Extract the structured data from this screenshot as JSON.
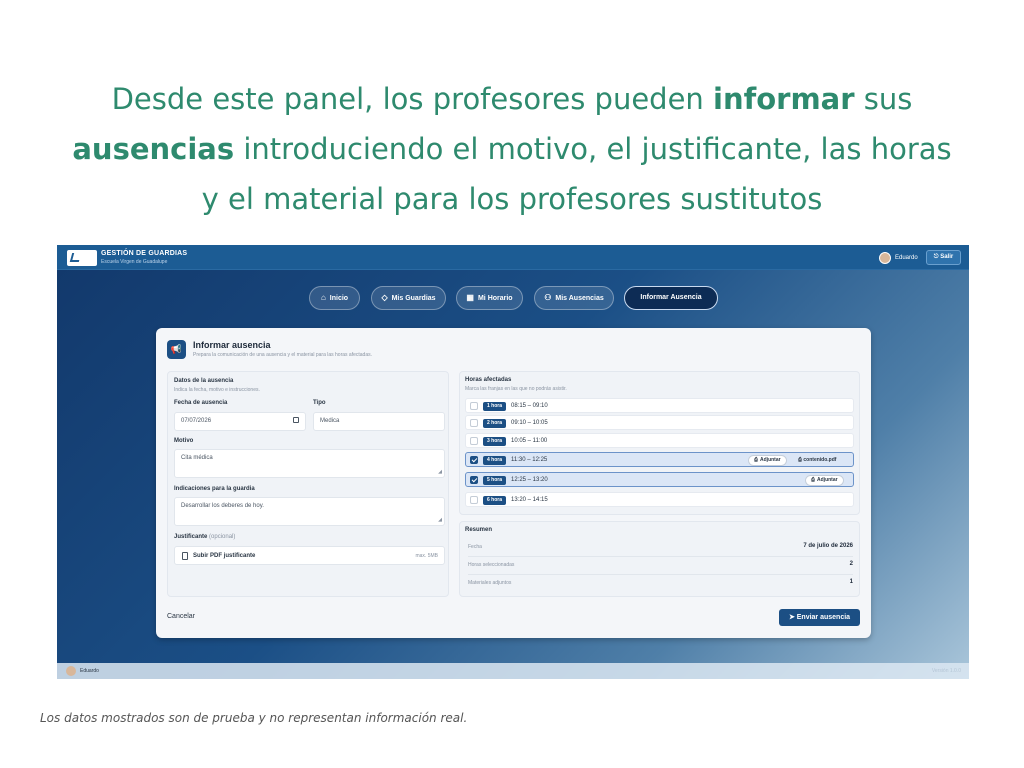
{
  "headline": {
    "part1": "Desde este panel, los profesores pueden ",
    "bold1": "informar",
    "part2": " sus ",
    "bold2": "ausencias",
    "part3": " introduciendo el motivo, el justificante, las horas y el material para los profesores sustitutos"
  },
  "app": {
    "title": "GESTIÓN DE GUARDIAS",
    "subtitle": "Escuela Virgen de Guadalupe",
    "user": "Eduardo",
    "logout": "Salir",
    "accent": "#1c4f84"
  },
  "nav": [
    {
      "label": "Inicio",
      "icon": "home-icon"
    },
    {
      "label": "Mis Guardias",
      "icon": "shield-icon"
    },
    {
      "label": "Mi Horario",
      "icon": "calendar-icon"
    },
    {
      "label": "Mis Ausencias",
      "icon": "users-icon"
    },
    {
      "label": "Informar Ausencia",
      "icon": "",
      "active": true
    }
  ],
  "form": {
    "title": "Informar ausencia",
    "subtitle": "Prepara la comunicación de una ausencia y el material para las horas afectadas.",
    "datos_title": "Datos de la ausencia",
    "datos_sub": "Indica la fecha, motivo e instrucciones.",
    "fecha_label": "Fecha de ausencia",
    "fecha_value": "07/07/2026",
    "tipo_label": "Tipo",
    "tipo_value": "Medica",
    "motivo_label": "Motivo",
    "motivo_value": "Cita médica",
    "indicaciones_label": "Indicaciones para la guardia",
    "indicaciones_value": "Desarrollar los deberes de hoy.",
    "justificante_label": "Justificante",
    "justificante_optional": "(opcional)",
    "upload_label": "Subir PDF justificante",
    "upload_max": "max. 5MB",
    "cancel": "Cancelar",
    "send": "Enviar ausencia"
  },
  "hours": {
    "title": "Horas afectadas",
    "subtitle": "Marca las franjas en las que no podrás asistir.",
    "rows": [
      {
        "badge": "1 hora",
        "time": "08:15 – 09:10",
        "selected": false
      },
      {
        "badge": "2 hora",
        "time": "09:10 – 10:05",
        "selected": false
      },
      {
        "badge": "3 hora",
        "time": "10:05 – 11:00",
        "selected": false
      },
      {
        "badge": "4 hora",
        "time": "11:30 – 12:25",
        "selected": true,
        "attach": "Adjuntar",
        "file": "contenido.pdf"
      },
      {
        "badge": "5 hora",
        "time": "12:25 – 13:20",
        "selected": true,
        "attach": "Adjuntar"
      },
      {
        "badge": "6 hora",
        "time": "13:20 – 14:15",
        "selected": false
      }
    ]
  },
  "summary": {
    "title": "Resumen",
    "fecha_label": "Fecha",
    "fecha_value": "7 de julio de 2026",
    "horas_label": "Horas seleccionadas",
    "horas_value": "2",
    "materiales_label": "Materiales adjuntos",
    "materiales_value": "1"
  },
  "footer": {
    "user": "Eduardo",
    "version": "Versión 1.0.0"
  },
  "disclaimer": "Los datos mostrados son de prueba y no representan información real."
}
